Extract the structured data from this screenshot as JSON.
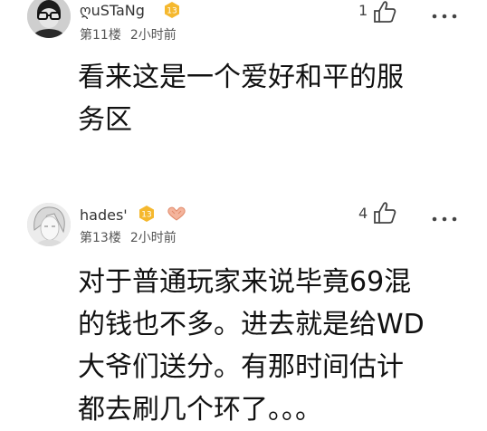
{
  "comments": [
    {
      "username": "ღuSTaNg",
      "level": "13",
      "floor": "第11楼",
      "time": "2小时前",
      "likes": "1",
      "text": "看来这是一个爱好和平的服\n务区",
      "avatar": "avatar-photo",
      "icons": [
        "level-badge-icon",
        "like-icon",
        "more-icon"
      ]
    },
    {
      "username": "hades'",
      "level": "13",
      "floor": "第13楼",
      "time": "2小时前",
      "likes": "4",
      "text": "对于普通玩家来说毕竟69混\n的钱也不多。进去就是给WD\n大爷们送分。有那时间估计\n都去刷几个环了。。。",
      "avatar": "avatar-photo",
      "icons": [
        "level-badge-icon",
        "heart-icon",
        "like-icon",
        "more-icon"
      ]
    }
  ],
  "colors": {
    "badge": "#f5b82e",
    "heart": "#f0a08a",
    "text": "#111111",
    "meta": "#555555"
  }
}
